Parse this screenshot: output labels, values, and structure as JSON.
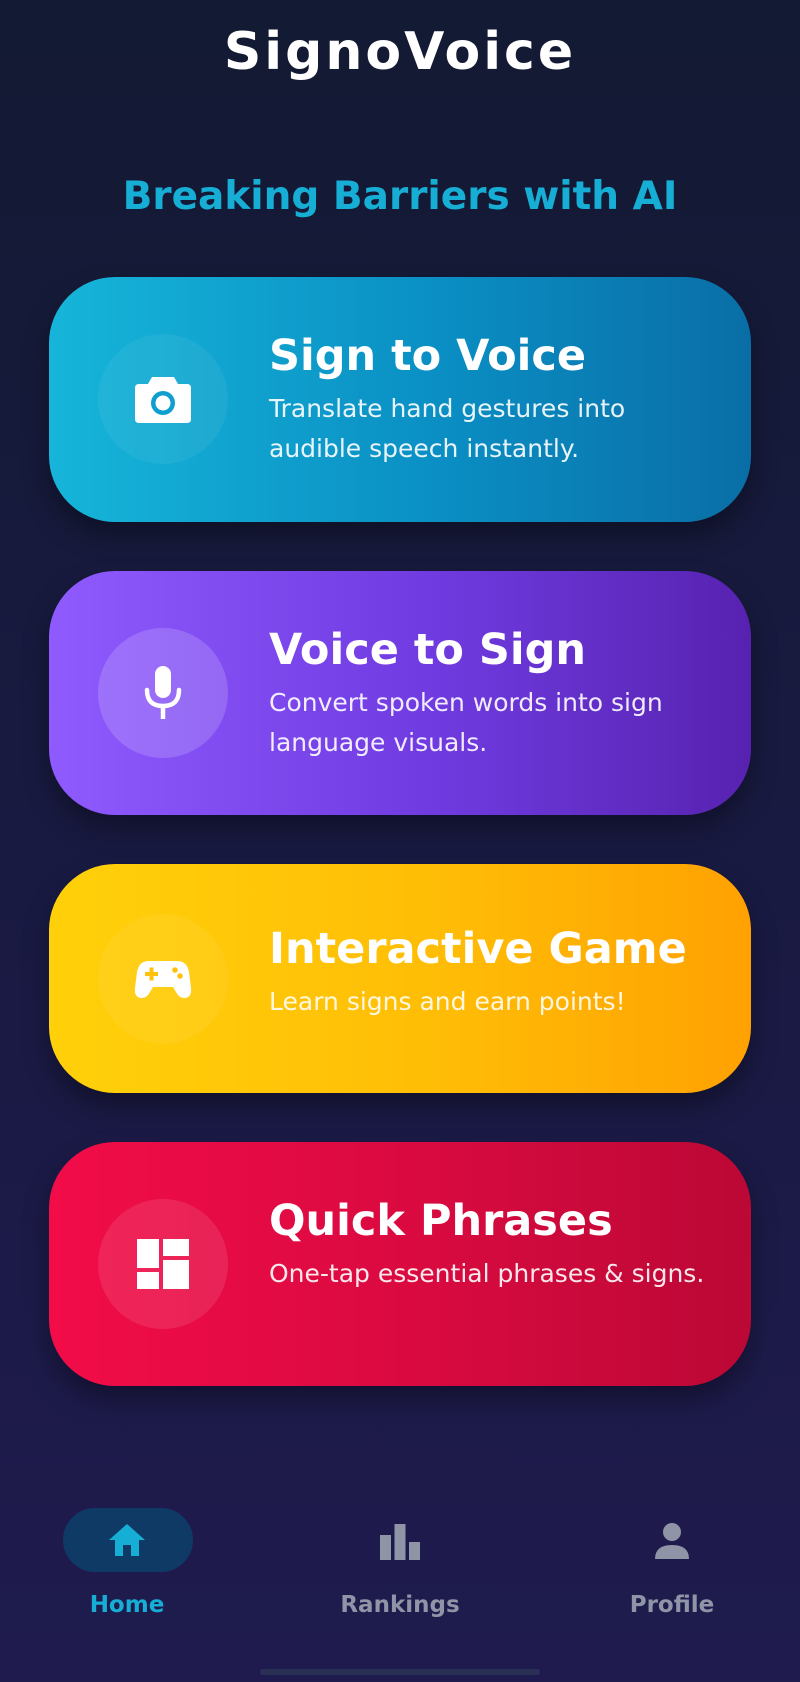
{
  "app": {
    "title": "SignoVoice",
    "tagline": "Breaking Barriers with AI"
  },
  "cards": [
    {
      "title": "Sign to Voice",
      "description": "Translate hand gestures into audible speech instantly.",
      "icon": "camera-icon",
      "color": "#0a8fc4"
    },
    {
      "title": "Voice to Sign",
      "description": "Convert spoken words into sign language visuals.",
      "icon": "microphone-icon",
      "color": "#6f3be0"
    },
    {
      "title": "Interactive Game",
      "description": "Learn signs and earn points!",
      "icon": "gamepad-icon",
      "color": "#ffbd06"
    },
    {
      "title": "Quick Phrases",
      "description": "One-tap essential phrases & signs.",
      "icon": "dashboard-grid-icon",
      "color": "#d80a40"
    }
  ],
  "nav": {
    "items": [
      {
        "label": "Home",
        "icon": "home-icon",
        "active": true
      },
      {
        "label": "Rankings",
        "icon": "bar-chart-icon",
        "active": false
      },
      {
        "label": "Profile",
        "icon": "person-icon",
        "active": false
      }
    ],
    "active_color": "#17aed6",
    "inactive_color": "#8f94a6"
  }
}
